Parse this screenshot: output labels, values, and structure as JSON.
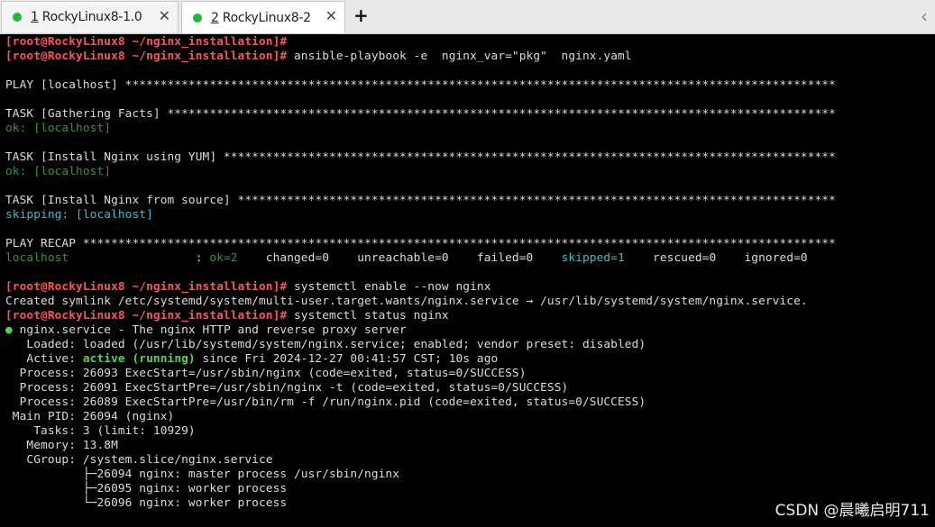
{
  "tabs": [
    {
      "number": "1",
      "title": "RockyLinux8-1.0",
      "close": "✕"
    },
    {
      "number": "2",
      "title": "RockyLinux8-2",
      "close": "✕"
    }
  ],
  "tabbar": {
    "new_tab": "+",
    "scroll_left": "‹"
  },
  "colors": {
    "prompt": "#ff5555",
    "ok": "#2e9a3a",
    "skipping": "#2fc4d4",
    "active": "#4cd84c",
    "tab_dot": "#22b83a"
  },
  "terminal": {
    "prompt": "[root@RockyLinux8 ~/nginx_installation]#",
    "command1": " ansible-playbook -e  nginx_var=\"pkg\"  nginx.yaml",
    "play": "PLAY [localhost] *****************************************************************************************************",
    "task_facts": "TASK [Gathering Facts] ***********************************************************************************************",
    "ok_localhost": "ok: [localhost]",
    "task_yum": "TASK [Install Nginx using YUM] ***************************************************************************************",
    "task_source": "TASK [Install Nginx from source] *************************************************************************************",
    "skipping_localhost": "skipping: [localhost]",
    "play_recap": "PLAY RECAP ***********************************************************************************************************",
    "recap_host": "localhost",
    "recap_colon": "                  : ",
    "recap_ok": "ok=2",
    "recap_mid": "    changed=0    unreachable=0    failed=0    ",
    "recap_skipped": "skipped=1",
    "recap_end": "    rescued=0    ignored=0",
    "command2": " systemctl enable --now nginx",
    "symlink": "Created symlink /etc/systemd/system/multi-user.target.wants/nginx.service → /usr/lib/systemd/system/nginx.service.",
    "command3": " systemctl status nginx",
    "status_dot": "●",
    "status_title": " nginx.service - The nginx HTTP and reverse proxy server",
    "loaded": "   Loaded: loaded (/usr/lib/systemd/system/nginx.service; enabled; vendor preset: disabled)",
    "active_label": "   Active: ",
    "active_state": "active (running)",
    "active_since": " since Fri 2024-12-27 00:41:57 CST; 10s ago",
    "process1": "  Process: 26093 ExecStart=/usr/sbin/nginx (code=exited, status=0/SUCCESS)",
    "process2": "  Process: 26091 ExecStartPre=/usr/sbin/nginx -t (code=exited, status=0/SUCCESS)",
    "process3": "  Process: 26089 ExecStartPre=/usr/bin/rm -f /run/nginx.pid (code=exited, status=0/SUCCESS)",
    "main_pid": " Main PID: 26094 (nginx)",
    "tasks": "    Tasks: 3 (limit: 10929)",
    "memory": "   Memory: 13.8M",
    "cgroup": "   CGroup: /system.slice/nginx.service",
    "cg1": "           ├─26094 nginx: master process /usr/sbin/nginx",
    "cg2": "           ├─26095 nginx: worker process",
    "cg3": "           └─26096 nginx: worker process"
  },
  "watermark": "CSDN @晨曦启明711"
}
